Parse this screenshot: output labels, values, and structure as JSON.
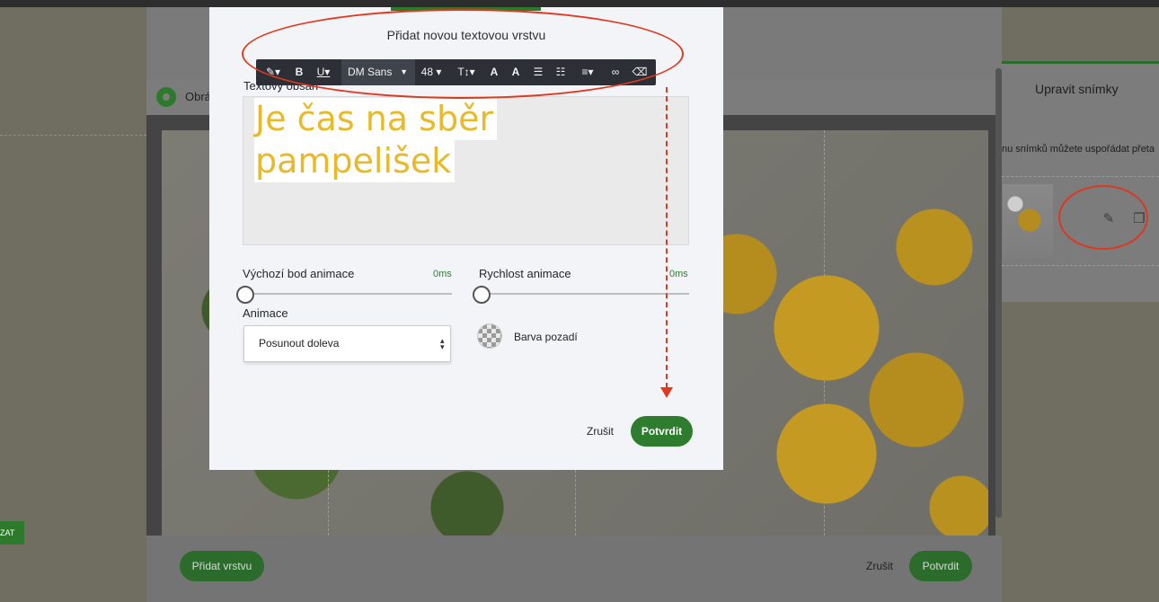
{
  "background": {
    "radio_label": "Obrá",
    "left_tag": "ZAT",
    "footer": {
      "add_layer": "Přidat vrstvu",
      "cancel": "Zrušit",
      "confirm": "Potvrdit"
    },
    "side_panel": {
      "title": "Upravit snímky",
      "description": "nu snímků můžete uspořádat přeta",
      "icons": [
        "pencil-icon",
        "duplicate-icon"
      ]
    }
  },
  "modal": {
    "title": "Přidat novou textovou vrstvu",
    "content_label": "Textový obsah",
    "toolbar": {
      "font": "DM Sans",
      "size": "48",
      "items": [
        "magic-wand-icon",
        "bold-icon",
        "underline-icon",
        "line-height-icon",
        "font-color-icon",
        "highlight-icon",
        "bullet-list-icon",
        "numbered-list-icon",
        "align-icon",
        "link-icon",
        "eraser-icon"
      ]
    },
    "editor": {
      "line1": "Je čas na sběr",
      "line2": "pampelišek",
      "text_color": "#e8b929"
    },
    "start_point_label": "Výchozí bod animace",
    "start_point_value": "0ms",
    "speed_label": "Rychlost animace",
    "speed_value": "0ms",
    "animation_label": "Animace",
    "animation_value": "Posunout doleva",
    "bg_color_label": "Barva pozadí",
    "cancel": "Zrušit",
    "confirm": "Potvrdit"
  },
  "colors": {
    "accent_green": "#2e7d2e",
    "annotation_red": "#e0391f",
    "toolbar_bg": "#2c2f36"
  }
}
